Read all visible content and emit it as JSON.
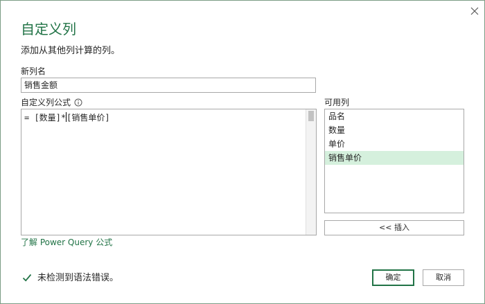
{
  "dialog": {
    "title": "自定义列",
    "subtitle": "添加从其他列计算的列。",
    "close_icon": "close-icon"
  },
  "new_column": {
    "label": "新列名",
    "value": "销售金额"
  },
  "formula": {
    "label": "自定义列公式",
    "info_icon": "info-icon",
    "before_caret": "= [数量]*",
    "after_caret": "[销售单价]"
  },
  "available_columns": {
    "label": "可用列",
    "items": [
      "品名",
      "数量",
      "单价",
      "销售单价"
    ],
    "selected": "销售单价"
  },
  "insert_button": {
    "label": "<< 插入"
  },
  "learn_link": {
    "label": "了解 Power Query 公式"
  },
  "status": {
    "icon": "checkmark-icon",
    "text": "未检测到语法错误。"
  },
  "buttons": {
    "ok": "确定",
    "cancel": "取消"
  },
  "colors": {
    "accent": "#217346",
    "selected_bg": "#d5f0dd",
    "border": "#a8a8a8"
  }
}
